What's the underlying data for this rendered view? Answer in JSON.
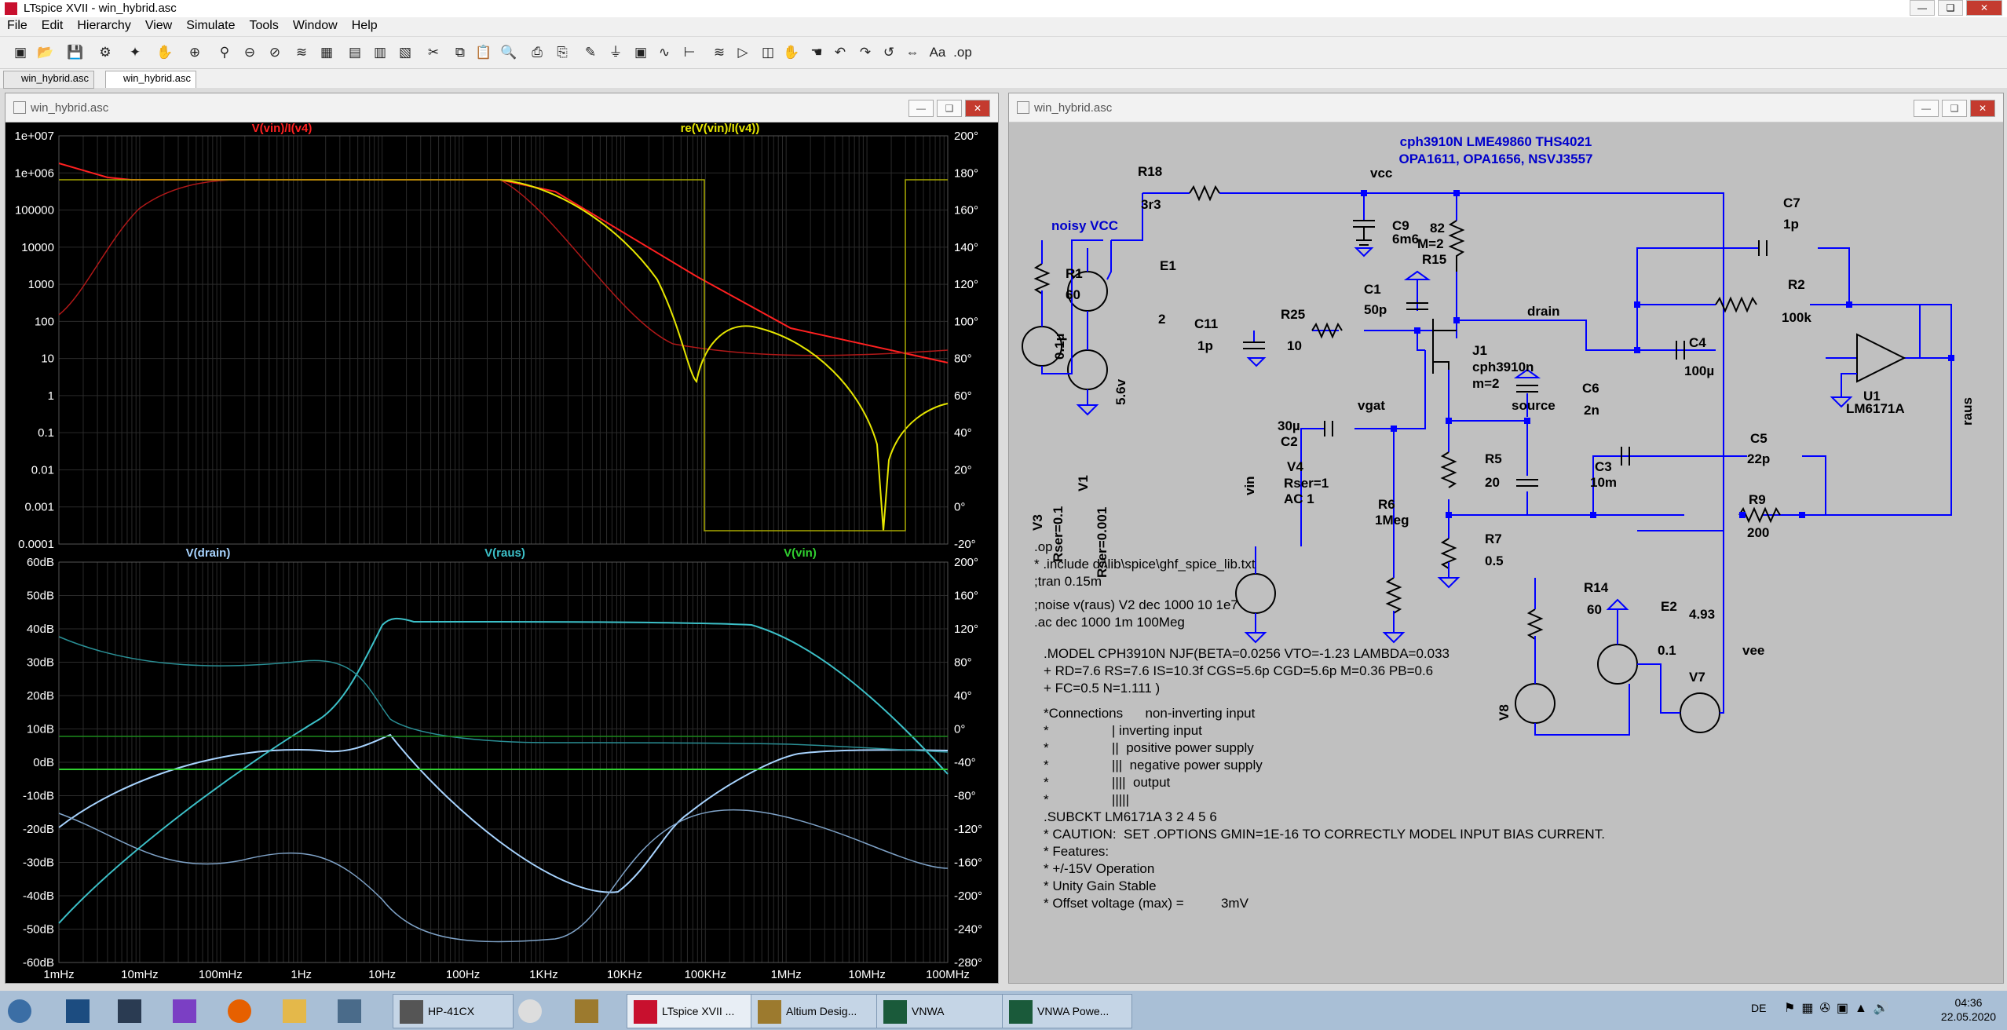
{
  "app": {
    "title": "LTspice XVII - win_hybrid.asc"
  },
  "menu": [
    "File",
    "Edit",
    "Hierarchy",
    "View",
    "Simulate",
    "Tools",
    "Window",
    "Help"
  ],
  "tabs": [
    "win_hybrid.asc",
    "win_hybrid.asc"
  ],
  "plot_window": {
    "title": "win_hybrid.asc",
    "top_pane": {
      "traces": [
        {
          "label": "V(vin)/I(v4)",
          "color": "#ff2020"
        },
        {
          "label": "re(V(vin)/I(v4))",
          "color": "#e6e600"
        }
      ],
      "left_ticks": [
        "1e+007",
        "1e+006",
        "100000",
        "10000",
        "1000",
        "100",
        "10",
        "1",
        "0.1",
        "0.01",
        "0.001",
        "0.0001"
      ],
      "right_ticks": [
        "200°",
        "180°",
        "160°",
        "140°",
        "120°",
        "100°",
        "80°",
        "60°",
        "40°",
        "20°",
        "0°",
        "-20°"
      ]
    },
    "bottom_pane": {
      "traces": [
        {
          "label": "V(drain)",
          "color": "#a8d4ff"
        },
        {
          "label": "V(raus)",
          "color": "#3cc0c8"
        },
        {
          "label": "V(vin)",
          "color": "#30d030"
        }
      ],
      "left_ticks": [
        "60dB",
        "50dB",
        "40dB",
        "30dB",
        "20dB",
        "10dB",
        "0dB",
        "-10dB",
        "-20dB",
        "-30dB",
        "-40dB",
        "-50dB",
        "-60dB"
      ],
      "right_ticks": [
        "200°",
        "160°",
        "120°",
        "80°",
        "40°",
        "0°",
        "-40°",
        "-80°",
        "-120°",
        "-160°",
        "-200°",
        "-240°",
        "-280°"
      ],
      "x_ticks": [
        "1mHz",
        "10mHz",
        "100mHz",
        "1Hz",
        "10Hz",
        "100Hz",
        "1KHz",
        "10KHz",
        "100KHz",
        "1MHz",
        "10MHz",
        "100MHz"
      ]
    }
  },
  "schematic_window": {
    "title": "win_hybrid.asc",
    "header1": "cph3910N LME49860 THS4021",
    "header2": "OPA1611, OPA1656, NSVJ3557",
    "labels": {
      "r18": "R18",
      "r18v": "3r3",
      "vcc": "vcc",
      "c9": "C9",
      "c9v": "6m6",
      "noisy": "noisy VCC",
      "r1": "R1",
      "r1v": "60",
      "e1": "E1",
      "e1v": "2",
      "v3v": "0.1µ",
      "v1v": "5.6v",
      "v3": "V3",
      "v3r": "Rser=0.1",
      "v1": "V1",
      "v1r": "Rser=0.001",
      "r15a": "82",
      "r15b": "M=2",
      "r15": "R15",
      "c1": "C1",
      "c1v": "50p",
      "c11": "C11",
      "c11v": "1p",
      "r25": "R25",
      "r25v": "10",
      "j1": "J1",
      "j1m": "cph3910n",
      "j1n": "m=2",
      "drain": "drain",
      "c7": "C7",
      "c7v": "1p",
      "r2": "R2",
      "r2v": "100k",
      "c4": "C4",
      "c4v": "100µ",
      "u1": "U1",
      "u1m": "LM6171A",
      "raus": "raus",
      "c6": "C6",
      "c6v": "2n",
      "source": "source",
      "vgat": "vgat",
      "c2v": "30µ",
      "c2": "C2",
      "vin": "vin",
      "v4": "V4",
      "v4r": "Rser=1",
      "v4ac": "AC 1",
      "r5": "R5",
      "r5v": "20",
      "c3": "C3",
      "c3v": "10m",
      "c5": "C5",
      "c5v": "22p",
      "r6": "R6",
      "r6v": "1Meg",
      "r7": "R7",
      "r7v": "0.5",
      "r9": "R9",
      "r9v": "200",
      "r14": "R14",
      "r14v": "60",
      "e2": "E2",
      "e2v": "0.1",
      "v7a": "4.93",
      "v7": "V7",
      "vee": "vee",
      "v8": "V8"
    },
    "directives": [
      ".op",
      "* .include d:\\lib\\spice\\ghf_spice_lib.txt",
      ";tran 0.15m",
      ";noise v(raus) V2 dec 1000 10 1e7",
      ".ac dec 1000 1m 100Meg",
      ".MODEL CPH3910N NJF(BETA=0.0256 VTO=-1.23 LAMBDA=0.033",
      "+ RD=7.6 RS=7.6 IS=10.3f CGS=5.6p CGD=5.6p M=0.36 PB=0.6",
      "+ FC=0.5 N=1.111 )",
      "*Connections      non-inverting input",
      "*                 | inverting input",
      "*                 ||  positive power supply",
      "*                 |||  negative power supply",
      "*                 ||||  output",
      "*                 |||||",
      ".SUBCKT LM6171A 3 2 4 5 6",
      "* CAUTION:  SET .OPTIONS GMIN=1E-16 TO CORRECTLY MODEL INPUT BIAS CURRENT.",
      "* Features:",
      "* +/-15V Operation",
      "* Unity Gain Stable",
      "* Offset voltage (max) =          3mV"
    ]
  },
  "taskbar": {
    "apps": [
      "HP-41CX",
      "LTspice XVII ...",
      "Altium Desig...",
      "VNWA",
      "VNWA Powe..."
    ],
    "lang": "DE",
    "time": "04:36",
    "date": "22.05.2020"
  }
}
